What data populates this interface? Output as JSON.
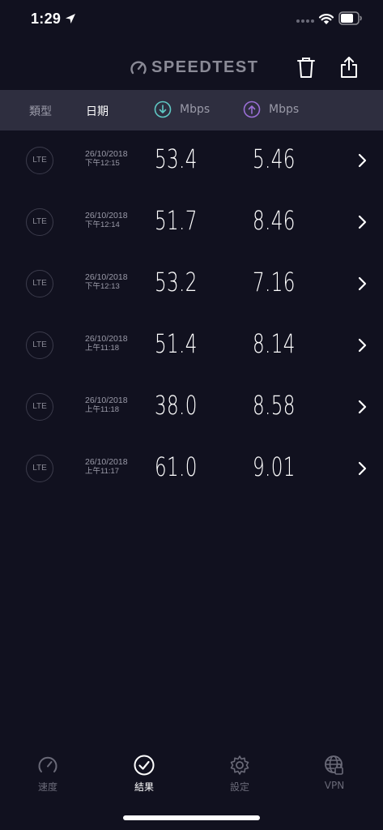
{
  "status_bar": {
    "time": "1:29"
  },
  "header": {
    "logo_text": "SPEEDTEST"
  },
  "columns": {
    "type": "類型",
    "date": "日期",
    "download": "Mbps",
    "upload": "Mbps"
  },
  "colors": {
    "background": "#11111f",
    "header_bar": "#2e2e3f",
    "download_accent": "#5fc8c4",
    "upload_accent": "#9b6fd6"
  },
  "results": [
    {
      "network": "LTE",
      "date": "26/10/2018",
      "time": "下午12:15",
      "download": "53.4",
      "upload": "5.46"
    },
    {
      "network": "LTE",
      "date": "26/10/2018",
      "time": "下午12:14",
      "download": "51.7",
      "upload": "8.46"
    },
    {
      "network": "LTE",
      "date": "26/10/2018",
      "time": "下午12:13",
      "download": "53.2",
      "upload": "7.16"
    },
    {
      "network": "LTE",
      "date": "26/10/2018",
      "time": "上午11:18",
      "download": "51.4",
      "upload": "8.14"
    },
    {
      "network": "LTE",
      "date": "26/10/2018",
      "time": "上午11:18",
      "download": "38.0",
      "upload": "8.58"
    },
    {
      "network": "LTE",
      "date": "26/10/2018",
      "time": "上午11:17",
      "download": "61.0",
      "upload": "9.01"
    }
  ],
  "tabs": [
    {
      "label": "速度",
      "icon": "speedometer-icon",
      "active": false
    },
    {
      "label": "結果",
      "icon": "check-circle-icon",
      "active": true
    },
    {
      "label": "設定",
      "icon": "gear-icon",
      "active": false
    },
    {
      "label": "VPN",
      "icon": "vpn-globe-lock-icon",
      "active": false
    }
  ]
}
